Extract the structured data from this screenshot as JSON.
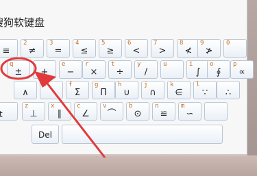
{
  "title": "搜狗软键盘",
  "rows": [
    [
      {
        "tl": "",
        "sym": "≡"
      },
      {
        "tl": "2",
        "sym": "≠"
      },
      {
        "tl": "3",
        "sym": "="
      },
      {
        "tl": "4",
        "sym": "≤"
      },
      {
        "tl": "5",
        "sym": "≥"
      },
      {
        "tl": "6",
        "sym": "<"
      },
      {
        "tl": "7",
        "sym": ">"
      },
      {
        "tl": "8",
        "sym": "≮"
      },
      {
        "tl": "9",
        "sym": "≯"
      },
      {
        "tl": "0",
        "sym": ""
      }
    ],
    [
      {
        "tl": "q",
        "sym": "±"
      },
      {
        "tl": "",
        "sym": "+"
      },
      {
        "tl": "e",
        "sym": "−"
      },
      {
        "tl": "r",
        "sym": "×"
      },
      {
        "tl": "t",
        "sym": "÷"
      },
      {
        "tl": "y",
        "sym": "/"
      },
      {
        "tl": "u",
        "sym": ""
      },
      {
        "tl": "i",
        "sym": "∫"
      },
      {
        "tl": "o",
        "sym": "∮"
      },
      {
        "tl": "p",
        "sym": "∝"
      }
    ],
    [
      {
        "tl": "",
        "sym": "∧"
      },
      {
        "tl": "d",
        "sym": ""
      },
      {
        "tl": "f",
        "sym": "Σ"
      },
      {
        "tl": "g",
        "sym": "Π"
      },
      {
        "tl": "h",
        "sym": "∪"
      },
      {
        "tl": "j",
        "sym": "∩"
      },
      {
        "tl": "k",
        "sym": "∈"
      },
      {
        "tl": "l",
        "sym": "∵"
      },
      {
        "tl": "",
        "sym": "∴"
      }
    ],
    [
      {
        "tl": "",
        "sym": "ft"
      },
      {
        "tl": "z",
        "sym": "⊥"
      },
      {
        "tl": "x",
        "sym": "∥"
      },
      {
        "tl": "c",
        "sym": "∠"
      },
      {
        "tl": "v",
        "sym": "⌒"
      },
      {
        "tl": "b",
        "sym": "⊙"
      },
      {
        "tl": "n",
        "sym": "≌"
      },
      {
        "tl": "m",
        "sym": "∽"
      },
      {
        "tl": "",
        "sym": ""
      }
    ]
  ],
  "delete_label": "Del",
  "space_label": "",
  "highlight_color": "#e23a3a"
}
